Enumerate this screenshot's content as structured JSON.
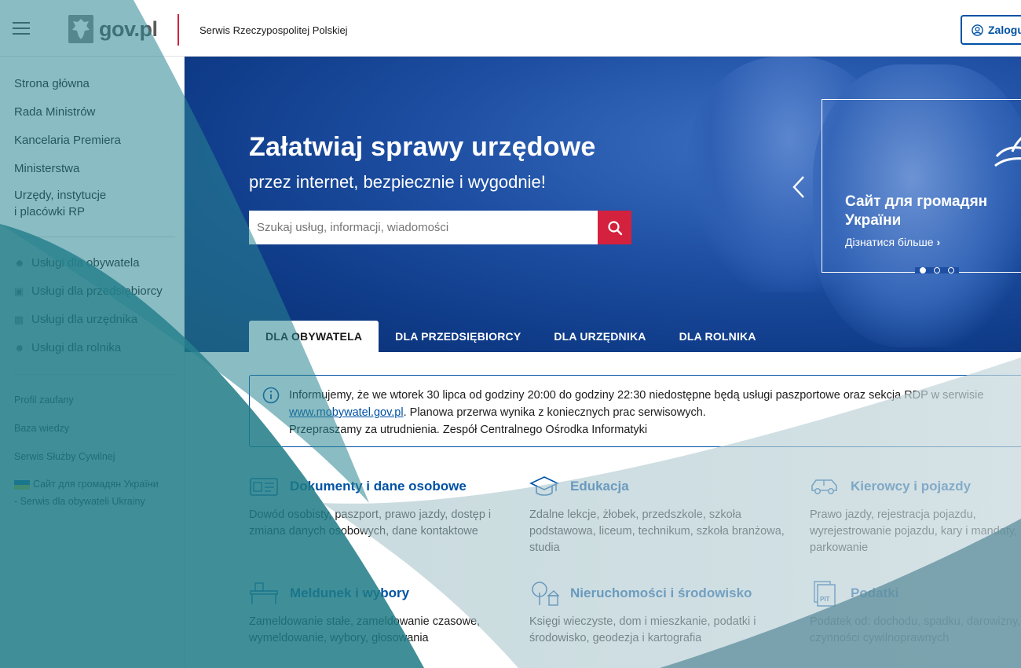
{
  "header": {
    "logo_text": "gov.pl",
    "subtitle": "Serwis Rzeczypospolitej Polskiej",
    "login_label": "Zalogu"
  },
  "sidebar": {
    "main_items": [
      {
        "label": "Strona główna"
      },
      {
        "label": "Rada Ministrów"
      },
      {
        "label": "Kancelaria Premiera"
      },
      {
        "label": "Ministerstwa"
      },
      {
        "label": "Urzędy, instytucje\ni placówki RP"
      }
    ],
    "service_items": [
      {
        "label": "Usługi dla obywatela",
        "icon": "person-icon"
      },
      {
        "label": "Usługi dla przedsiębiorcy",
        "icon": "briefcase-icon"
      },
      {
        "label": "Usługi dla urzędnika",
        "icon": "monitor-icon"
      },
      {
        "label": "Usługi dla rolnika",
        "icon": "farmer-icon"
      }
    ],
    "small_items": [
      {
        "label": "Profil zaufany"
      },
      {
        "label": "Baza wiedzy"
      },
      {
        "label": "Serwis Służby Cywilnej"
      },
      {
        "label": "Сайт для громадян України"
      },
      {
        "label": "- Serwis dla obywateli Ukrainy"
      }
    ]
  },
  "hero": {
    "title": "Załatwiaj sprawy urzędowe",
    "subtitle": "przez internet, bezpiecznie i wygodnie!",
    "search_placeholder": "Szukaj usług, informacji, wiadomości",
    "promo_title": "Сайт для громадян України",
    "promo_link": "Дізнатися більше",
    "tabs": [
      {
        "label": "DLA OBYWATELA",
        "active": true
      },
      {
        "label": "DLA PRZEDSIĘBIORCY",
        "active": false
      },
      {
        "label": "DLA URZĘDNIKA",
        "active": false
      },
      {
        "label": "DLA ROLNIKA",
        "active": false
      }
    ]
  },
  "notice": {
    "line1": "Informujemy, że we wtorek 30 lipca od godziny 20:00 do godziny 22:30 niedostępne będą usługi paszportowe oraz sekcja RDP w serwisie",
    "link": "www.mobywatel.gov.pl",
    "line2_rest": ". Planowa przerwa wynika z koniecznych prac serwisowych.",
    "line3": "Przepraszamy za utrudnienia. Zespół Centralnego Ośrodka Informatyki"
  },
  "categories": [
    {
      "title": "Dokumenty i dane osobowe",
      "desc": "Dowód osobisty, paszport, prawo jazdy, dostęp i zmiana danych osobowych, dane kontaktowe",
      "icon": "id-card-icon"
    },
    {
      "title": "Edukacja",
      "desc": "Zdalne lekcje, żłobek, przedszkole, szkoła podstawowa, liceum, technikum, szkoła branżowa, studia",
      "icon": "graduation-cap-icon"
    },
    {
      "title": "Kierowcy i pojazdy",
      "desc": "Prawo jazdy, rejestracja pojazdu, wyrejestrowanie pojazdu, kary i mandaty, parkowanie",
      "icon": "car-icon"
    },
    {
      "title": "Meldunek i wybory",
      "desc": "Zameldowanie stałe, zameldowanie czasowe, wymeldowanie, wybory, głosowania",
      "icon": "desk-icon"
    },
    {
      "title": "Nieruchomości i środowisko",
      "desc": "Księgi wieczyste, dom i mieszkanie, podatki i środowisko, geodezja i kartografia",
      "icon": "tree-house-icon"
    },
    {
      "title": "Podatki",
      "desc": "Podatek od: dochodu, spadku, darowizny, czynności cywilnoprawnych",
      "icon": "pit-document-icon"
    }
  ],
  "colors": {
    "accent_blue": "#0052a5",
    "accent_red": "#d4213d",
    "overlay_teal": "#1f7b86"
  }
}
